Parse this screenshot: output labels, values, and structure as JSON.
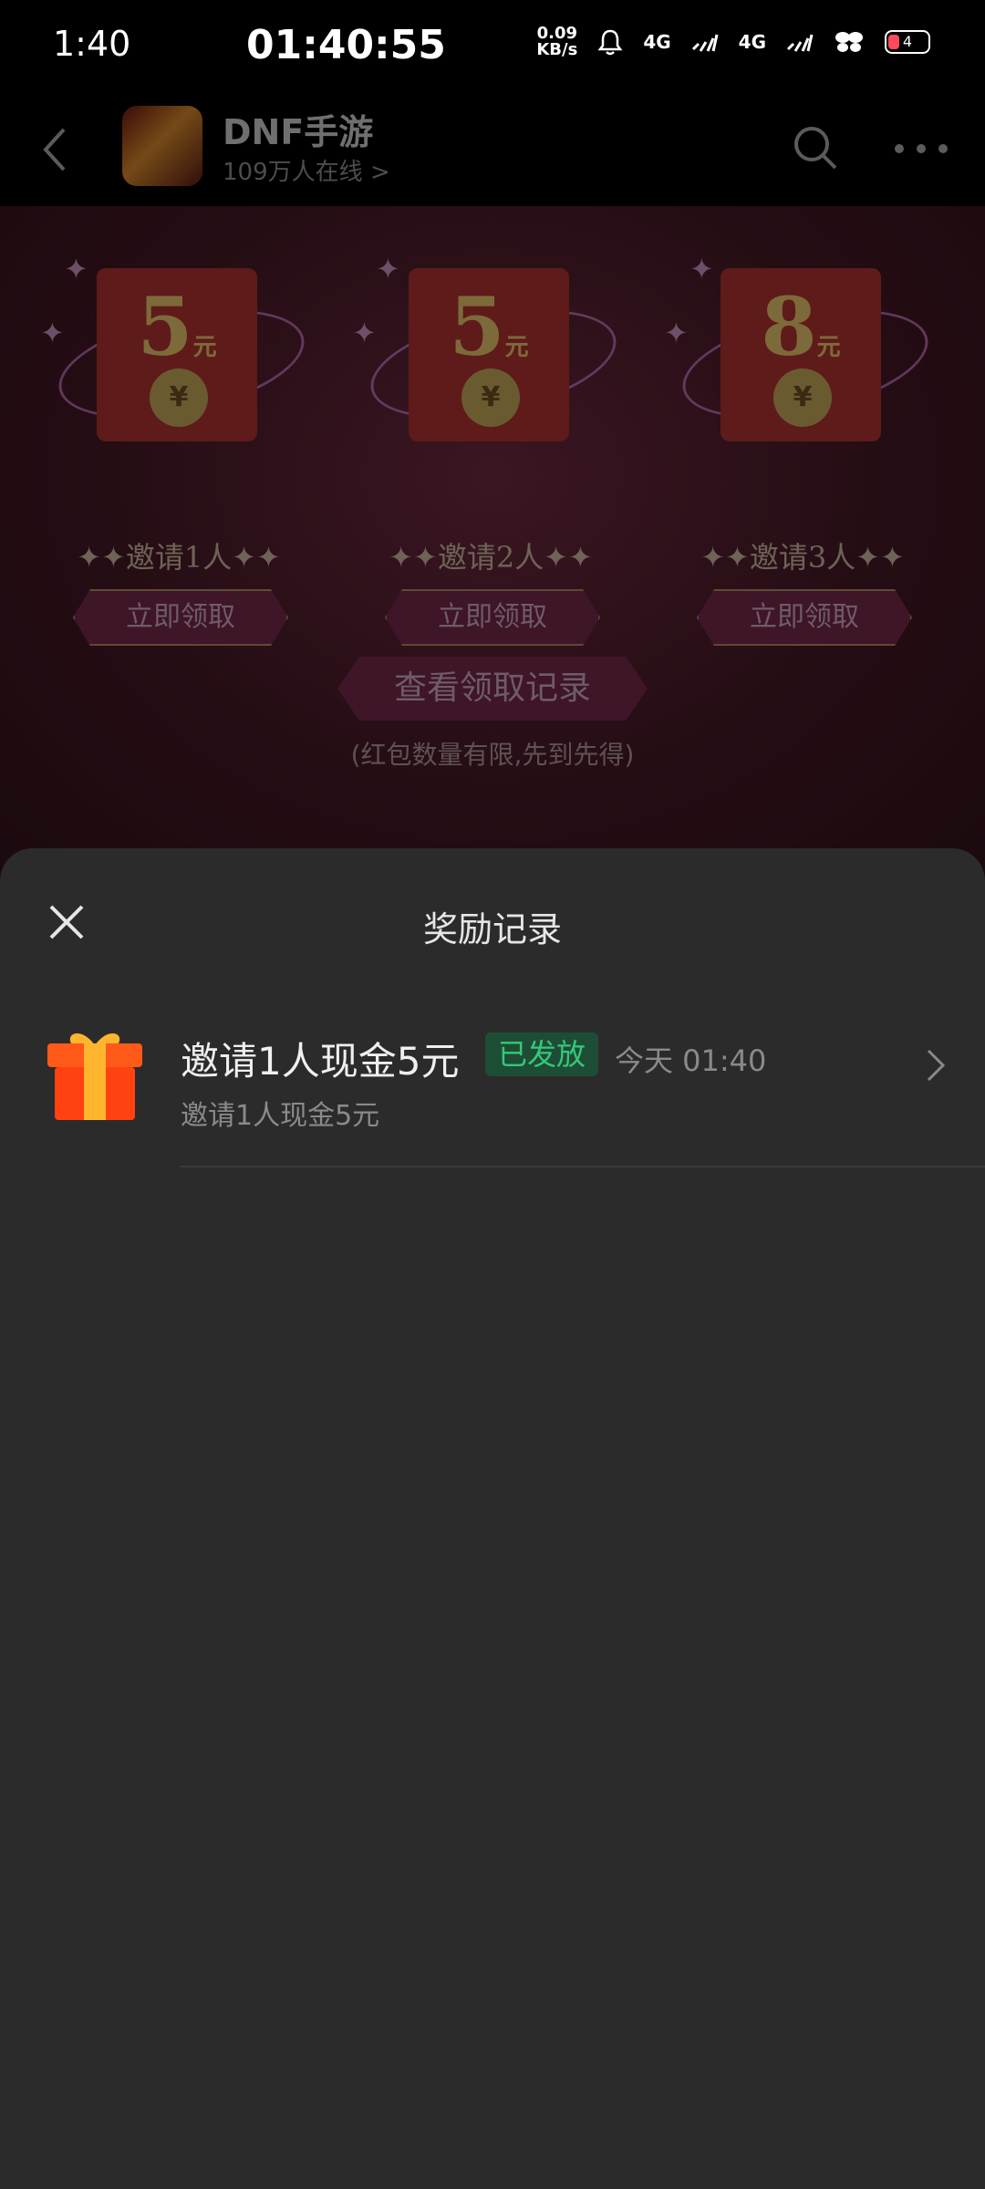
{
  "status_bar": {
    "time": "1:40",
    "clock": "01:40:55",
    "net_speed_value": "0.09",
    "net_speed_unit": "KB/s",
    "signal1": "4G",
    "signal2": "4G",
    "battery": "4"
  },
  "header": {
    "title": "DNF手游",
    "online": "109万人在线 >"
  },
  "background": {
    "envelopes": [
      {
        "amount": "5",
        "unit": "元",
        "label": "✦✦邀请1人✦✦",
        "button": "立即领取"
      },
      {
        "amount": "5",
        "unit": "元",
        "label": "✦✦邀请2人✦✦",
        "button": "立即领取"
      },
      {
        "amount": "8",
        "unit": "元",
        "label": "✦✦邀请3人✦✦",
        "button": "立即领取"
      }
    ],
    "coin_symbol": "¥",
    "records_button": "查看领取记录",
    "limited_note": "(红包数量有限,先到先得)"
  },
  "sheet": {
    "title": "奖励记录",
    "records": [
      {
        "title": "邀请1人现金5元",
        "status": "已发放",
        "time": "今天 01:40",
        "subtitle": "邀请1人现金5元"
      }
    ]
  },
  "colors": {
    "status_green": "#37c77a",
    "sheet_bg": "#2b2b2b"
  }
}
